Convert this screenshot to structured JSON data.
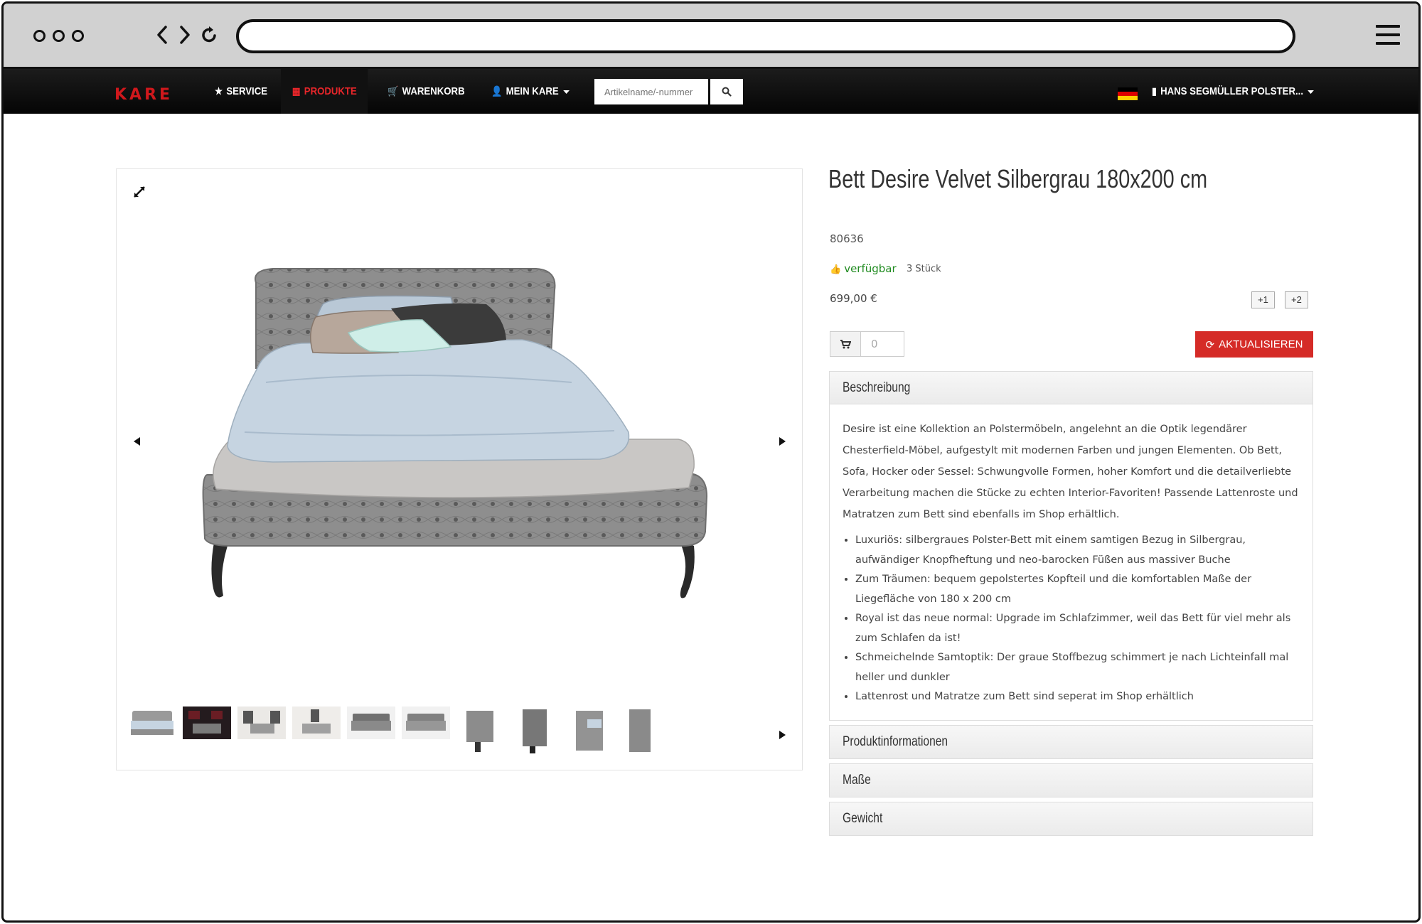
{
  "nav": {
    "logo": "KARE",
    "service": "SERVICE",
    "produkte": "PRODUKTE",
    "warenkorb": "WARENKORB",
    "mein_kare": "MEIN KARE",
    "search_placeholder": "Artikelname/-nummer",
    "account": "HANS SEGMÜLLER POLSTER..."
  },
  "product": {
    "title": "Bett Desire Velvet Silbergrau 180x200 cm",
    "sku": "80636",
    "availability": "verfügbar",
    "stock": "3 Stück",
    "price": "699,00 €",
    "plus1": "+1",
    "plus2": "+2",
    "quantity": "0",
    "update_label": "AKTUALISIEREN"
  },
  "panels": {
    "beschreibung": "Beschreibung",
    "description": "Desire ist eine Kollektion an Polstermöbeln, angelehnt an die Optik legendärer Chesterfield-Möbel, aufgestylt mit modernen Farben und jungen Elementen. Ob Bett, Sofa, Hocker oder Sessel: Schwungvolle Formen, hoher Komfort und die detailverliebte Verarbeitung machen die Stücke zu echten Interior-Favoriten! Passende Lattenroste und Matratzen zum Bett sind ebenfalls im Shop erhältlich.",
    "bullets": [
      "Luxuriös: silbergraues Polster-Bett mit einem samtigen Bezug in Silbergrau, aufwändiger Knopfheftung und neo-barocken Füßen aus massiver Buche",
      "Zum Träumen: bequem gepolstertes Kopfteil und die komfortablen Maße der Liegefläche von 180 x 200 cm",
      "Royal ist das neue normal: Upgrade im Schlafzimmer, weil das Bett für viel mehr als zum Schlafen da ist!",
      "Schmeichelnde Samtoptik: Der graue Stoffbezug schimmert je nach Lichteinfall mal heller und dunkler",
      "Lattenrost und Matratze zum Bett sind seperat im Shop erhältlich"
    ],
    "produktinformationen": "Produktinformationen",
    "masse": "Maße",
    "gewicht": "Gewicht"
  },
  "colors": {
    "brand_red": "#d0181c",
    "available_green": "#1e8a1e",
    "button_red": "#d52b27"
  }
}
